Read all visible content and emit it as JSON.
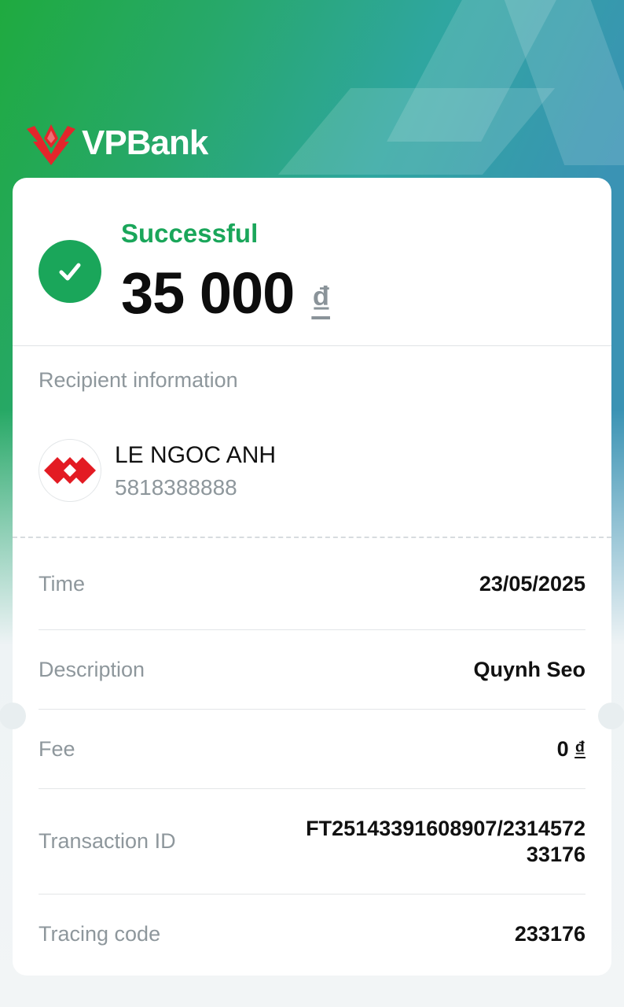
{
  "brand": {
    "name": "VPBank"
  },
  "status": {
    "label": "Successful",
    "amount": "35 000",
    "currency": "₫"
  },
  "recipient": {
    "section_title": "Recipient information",
    "name": "LE NGOC ANH",
    "account": "5818388888"
  },
  "details": [
    {
      "key": "Time",
      "value": "23/05/2025"
    },
    {
      "key": "Description",
      "value": "Quynh Seo"
    },
    {
      "key": "Fee",
      "value": "0",
      "currency": "₫"
    },
    {
      "key": "Transaction ID",
      "value_line1": "FT25143391608907/2314572",
      "value_line2": "33176"
    },
    {
      "key": "Tracing code",
      "value": "233176"
    }
  ],
  "colors": {
    "success": "#1aa65a",
    "brand_red": "#e3262b",
    "bank_logo_red": "#e31b23"
  },
  "icons": [
    "vpbank-logo-icon",
    "success-check-icon",
    "recipient-bank-logo-icon"
  ]
}
